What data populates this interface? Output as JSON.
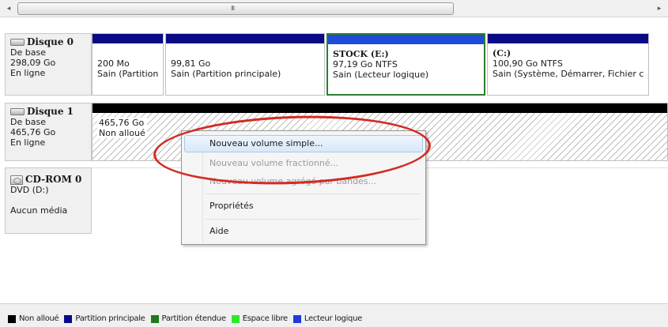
{
  "scrollbar": {
    "left_arrow": "◂",
    "right_arrow": "▸",
    "grip": "III"
  },
  "disks": [
    {
      "name": "Disque 0",
      "type": "De base",
      "size": "298,09 Go",
      "status": "En ligne",
      "partitions": [
        {
          "volume": "",
          "size": "200 Mo",
          "status": "Sain (Partition"
        },
        {
          "volume": "",
          "size": "99,81 Go",
          "status": "Sain (Partition principale)"
        },
        {
          "volume": "STOCK  (E:)",
          "size": "97,19 Go NTFS",
          "status": "Sain (Lecteur logique)"
        },
        {
          "volume": "(C:)",
          "size": "100,90 Go NTFS",
          "status": "Sain (Système, Démarrer, Fichier c"
        }
      ]
    },
    {
      "name": "Disque 1",
      "type": "De base",
      "size": "465,76 Go",
      "status": "En ligne",
      "unallocated": {
        "size": "465,76 Go",
        "label": "Non alloué"
      }
    },
    {
      "name": "CD-ROM 0",
      "type": "DVD (D:)",
      "status": "Aucun média"
    }
  ],
  "context_menu": {
    "items": [
      {
        "label": "Nouveau volume simple...",
        "enabled": true,
        "highlighted": true
      },
      {
        "label": "Nouveau volume fractionné...",
        "enabled": false
      },
      {
        "label": "Nouveau volume agrégé par bandes...",
        "enabled": false
      },
      {
        "label": "Propriétés",
        "enabled": true
      },
      {
        "label": "Aide",
        "enabled": true
      }
    ]
  },
  "legend": [
    {
      "label": "Non alloué",
      "color": "#000000"
    },
    {
      "label": "Partition principale",
      "color": "#0a0a86"
    },
    {
      "label": "Partition étendue",
      "color": "#1f7a1f"
    },
    {
      "label": "Espace libre",
      "color": "#2ee82e"
    },
    {
      "label": "Lecteur logique",
      "color": "#1e3adf"
    }
  ],
  "colors": {
    "annotation_ellipse": "#d32a22",
    "selection_border": "#2b7f2f",
    "menu_highlight": "#d8e8f9"
  }
}
